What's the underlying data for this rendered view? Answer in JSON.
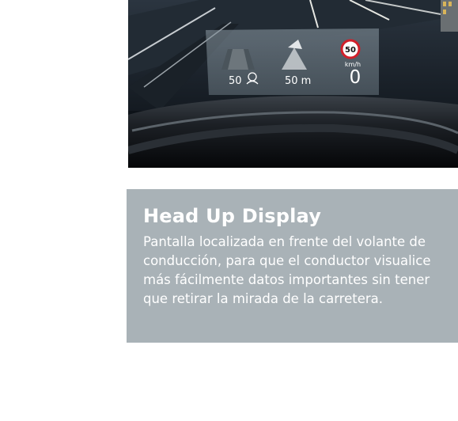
{
  "hero": {
    "hud_speed_sign": "50",
    "hud_unit": "km/h",
    "hud_current_speed": "0",
    "hud_distance": "50 m",
    "hud_acc_speed": "50"
  },
  "card": {
    "title": "Head Up Display",
    "description": "Pantalla localizada en frente del volante de conducción, para que el conductor visualice más fácilmente datos importantes sin tener que retirar la mirada de la carretera."
  },
  "colors": {
    "card_background": "#a9b2b7",
    "card_text": "#ffffff",
    "speed_sign_border": "#d0202a"
  }
}
